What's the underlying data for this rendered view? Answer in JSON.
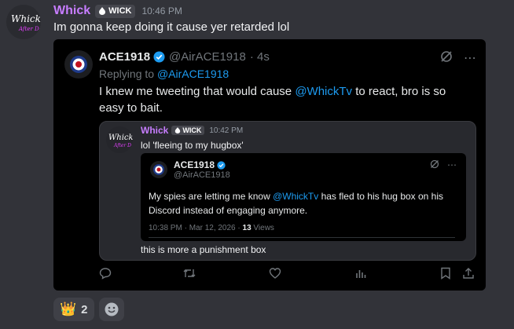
{
  "author": {
    "username": "Whick",
    "tag": "WICK",
    "timestamp": "10:46 PM",
    "message": "Im gonna keep doing it cause yer retarded lol"
  },
  "tweet": {
    "display_name": "ACE1918",
    "handle": "@AirACE1918",
    "age": "· 4s",
    "replying_prefix": "Replying to",
    "replying_to": "@AirACE1918",
    "text_before": "I knew me tweeting that would cause ",
    "mention": "@WhickTv",
    "text_after": " to react, bro is so easy to bait."
  },
  "quoted_message": {
    "username": "Whick",
    "tag": "WICK",
    "timestamp": "10:42 PM",
    "message": "lol 'fleeing to my hugbox'",
    "footer": "this is more a punishment box"
  },
  "inner_tweet": {
    "display_name": "ACE1918",
    "handle": "@AirACE1918",
    "text_before": "My spies are letting me know ",
    "mention": "@WhickTv",
    "text_after": " has fled to his hug box on his Discord instead of engaging anymore.",
    "meta_time": "10:38 PM · Mar 12, 2026 · ",
    "views_count": "13",
    "views_label": " Views"
  },
  "reactions": [
    {
      "emoji": "👑",
      "count": "2"
    }
  ],
  "colors": {
    "accent_purple": "#c77dff",
    "link_blue": "#1d9bf0",
    "background": "#323339"
  },
  "icons": [
    "grok-icon",
    "more-icon",
    "reply-icon",
    "retweet-icon",
    "like-icon",
    "views-icon",
    "bookmark-icon",
    "share-icon",
    "add-reaction-icon",
    "verified-icon"
  ]
}
